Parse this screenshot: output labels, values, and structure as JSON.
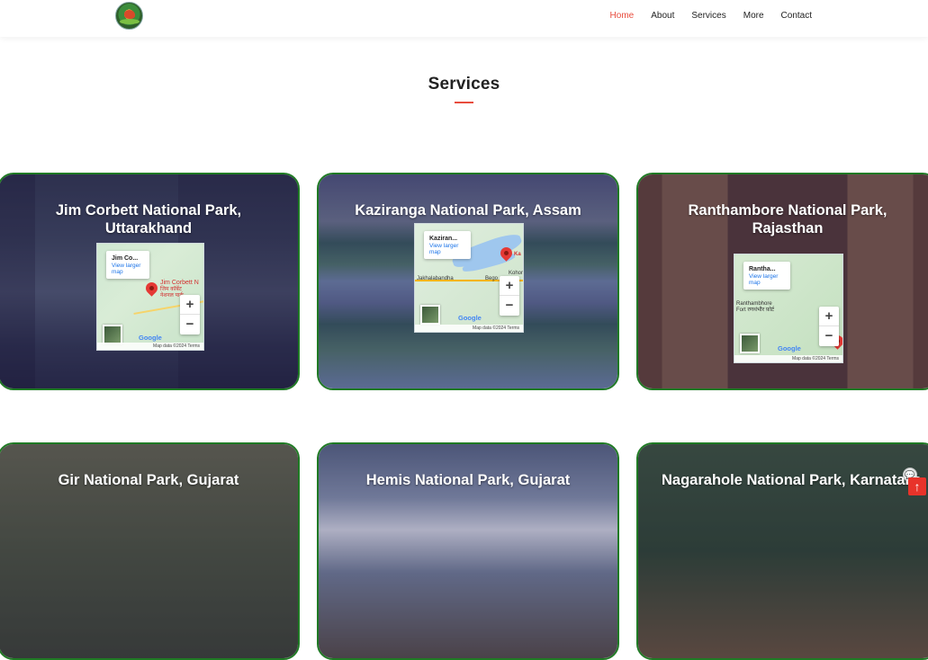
{
  "nav": {
    "items": [
      {
        "label": "Home",
        "active": true
      },
      {
        "label": "About",
        "active": false
      },
      {
        "label": "Services",
        "active": false
      },
      {
        "label": "More",
        "active": false
      },
      {
        "label": "Contact",
        "active": false
      }
    ]
  },
  "section": {
    "title": "Services"
  },
  "cards": [
    {
      "title": "Jim Corbett National Park, Uttarakhand",
      "map": {
        "place": "Jim Co...",
        "link": "View larger map",
        "marker_label": "Jim Corbett N",
        "marker_sublabel": "जिम कॉर्बेट नेशनल पार्क",
        "google": "Google",
        "attribution": "Map data ©2024  Terms"
      }
    },
    {
      "title": "Kaziranga National Park, Assam",
      "map": {
        "place": "Kaziran...",
        "link": "View larger map",
        "marker_label": "Ka",
        "town1": "Jakhalabandha",
        "town2": "Bego",
        "town3": "Kohor",
        "google": "Google",
        "attribution": "Map data ©2024  Terms"
      }
    },
    {
      "title": "Ranthambore National Park, Rajasthan",
      "map": {
        "place": "Rantha...",
        "link": "View larger map",
        "marker_label": "Ranthambhore Fort रणथंभौर फ़ोर्ट",
        "google": "Google",
        "attribution": "Map data ©2024  Terms"
      }
    },
    {
      "title": "Gir National Park, Gujarat"
    },
    {
      "title": "Hemis National Park, Gujarat"
    },
    {
      "title": "Nagarahole National Park, Karnataka"
    }
  ],
  "widgets": {
    "scroll_top": "↑",
    "chat": "💬"
  },
  "colors": {
    "accent": "#e84c3d",
    "card_border": "#1f7a24"
  }
}
